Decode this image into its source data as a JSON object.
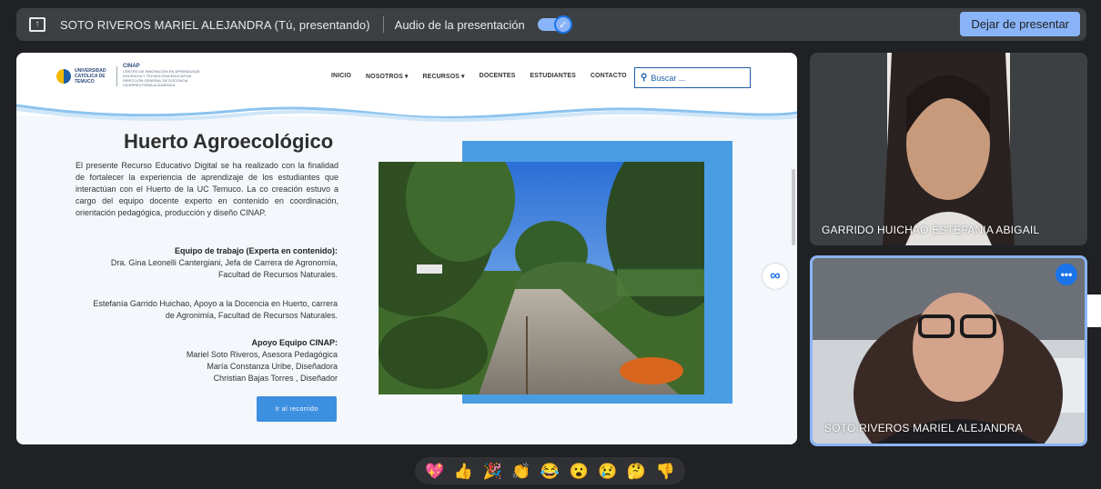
{
  "topbar": {
    "presenter": "SOTO RIVEROS MARIEL ALEJANDRA (Tú, presentando)",
    "audio_label": "Audio de la presentación",
    "stop_button": "Dejar de presentar"
  },
  "site": {
    "logo_text": "UNIVERSIDAD CATÓLICA DE TEMUCO",
    "cinap_title": "CINAP",
    "cinap_sub": "CENTRO DE INNOVACIÓN EN APRENDIZAJE DOCENCIA Y TECNOLOGÍA EDUCATIVA DIRECCIÓN GENERAL DE DOCENCIA VICERRECTORÍA ACADÉMICA",
    "nav": [
      "INICIO",
      "NOSOTROS ▾",
      "RECURSOS ▾",
      "DOCENTES",
      "ESTUDIANTES",
      "CONTACTO"
    ],
    "search_placeholder": "Buscar ...",
    "title": "Huerto Agroecológico",
    "intro": "El presente Recurso Educativo Digital se ha realizado con la finalidad de fortalecer la experiencia de aprendizaje de los estudiantes que interactúan con el Huerto de la UC Temuco. La co creación estuvo a cargo del equipo docente experto en contenido en coordinación, orientación pedagógica, producción y diseño CINAP.",
    "team_heading": "Equipo de trabajo (Experta en contenido):",
    "team_line1": "Dra. Gina Leonelli Cantergiani, Jefa de Carrera de Agronomía,",
    "team_line2": "Facultad de Recursos Naturales.",
    "support_line1": "Estefanía Garrido Huichao, Apoyo a la Docencia en Huerto, carrera",
    "support_line2": "de Agronimía, Facultad de Recursos Naturales.",
    "cinap_heading": "Apoyo Equipo CINAP:",
    "cinap_line1": "Mariel Soto Riveros, Asesora Pedagógica",
    "cinap_line2": "María Constanza Uribe, Diseñadora",
    "cinap_line3": "Christian Bajas Torres , Diseñador",
    "cta": "Ir al recorrido"
  },
  "participants": [
    {
      "name": "GARRIDO HUICHAO ESTEFANIA ABIGAIL"
    },
    {
      "name": "SOTO RIVEROS MARIEL ALEJANDRA"
    }
  ],
  "reactions": [
    "💖",
    "👍",
    "🎉",
    "👏",
    "😂",
    "😮",
    "😢",
    "🤔",
    "👎"
  ],
  "icons": {
    "present": "present-icon",
    "toggle_check": "check-icon",
    "companion": "infinity-icon",
    "more": "more-options-icon"
  },
  "colors": {
    "meet_blue": "#8ab4f8",
    "site_blue": "#3d8fe0",
    "background": "#202124"
  }
}
